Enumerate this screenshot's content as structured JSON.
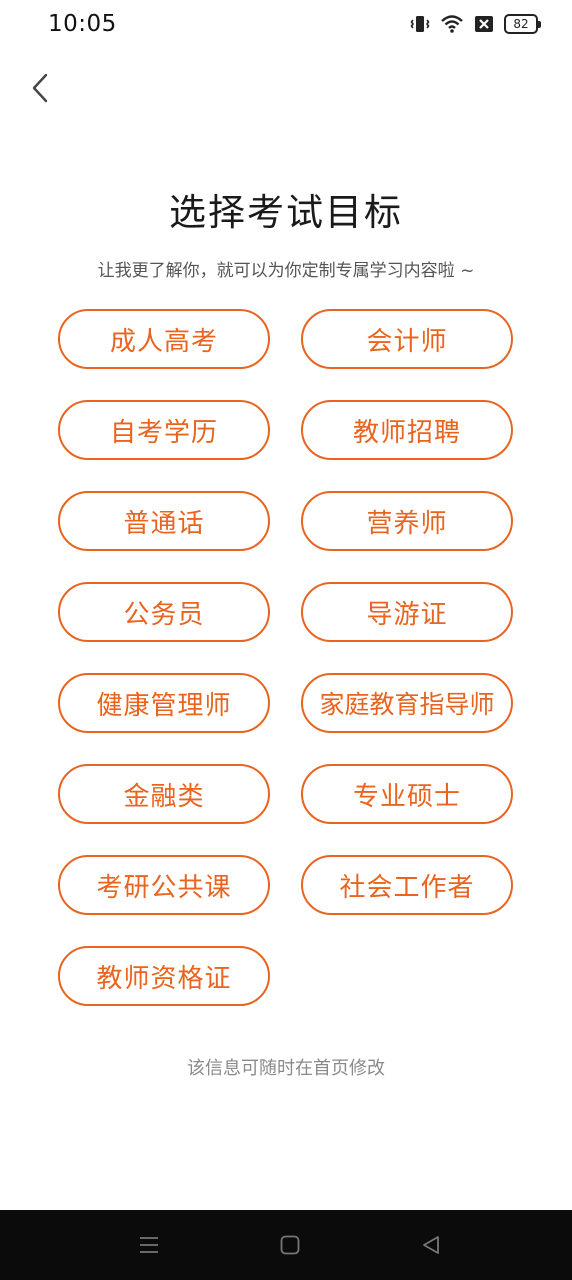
{
  "status_bar": {
    "time": "10:05",
    "battery": "82",
    "icons": [
      "vibrate-icon",
      "wifi-icon",
      "sim-off-icon",
      "battery-icon"
    ]
  },
  "header": {
    "back_icon": "chevron-left-icon"
  },
  "main": {
    "title": "选择考试目标",
    "subtitle": "让我更了解你，就可以为你定制专属学习内容啦 ~",
    "options": [
      "成人高考",
      "会计师",
      "自考学历",
      "教师招聘",
      "普通话",
      "营养师",
      "公务员",
      "导游证",
      "健康管理师",
      "家庭教育指导师",
      "金融类",
      "专业硕士",
      "考研公共课",
      "社会工作者",
      "教师资格证"
    ],
    "footer_note": "该信息可随时在首页修改"
  },
  "nav_bar": {
    "icons": [
      "menu-icon",
      "home-icon",
      "back-triangle-icon"
    ]
  },
  "colors": {
    "accent": "#e8641f",
    "nav_background": "#0b0b0b"
  }
}
